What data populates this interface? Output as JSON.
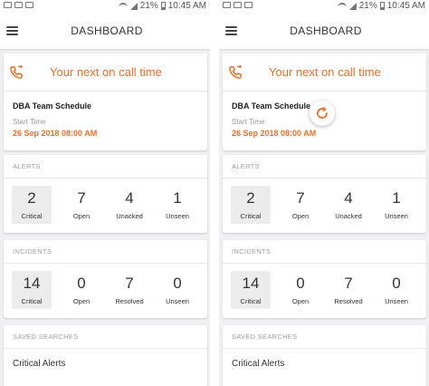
{
  "status_bar": {
    "battery": "21%",
    "time": "10:45 AM"
  },
  "app_bar": {
    "title": "DASHBOARD"
  },
  "on_call": {
    "title": "Your next on call time",
    "schedule_name": "DBA Team Schedule",
    "start_label": "Start Time",
    "start_value": "26 Sep 2018 08:00 AM"
  },
  "alerts": {
    "label": "ALERTS",
    "stats": [
      {
        "value": "2",
        "label": "Critical"
      },
      {
        "value": "7",
        "label": "Open"
      },
      {
        "value": "4",
        "label": "Unacked"
      },
      {
        "value": "1",
        "label": "Unseen"
      }
    ]
  },
  "incidents": {
    "label": "INCIDENTS",
    "stats": [
      {
        "value": "14",
        "label": "Critical"
      },
      {
        "value": "0",
        "label": "Open"
      },
      {
        "value": "7",
        "label": "Resolved"
      },
      {
        "value": "0",
        "label": "Unseen"
      }
    ]
  },
  "saved_searches": {
    "label": "SAVED SEARCHES",
    "items": [
      "Critical Alerts"
    ]
  },
  "colors": {
    "accent": "#e8702a"
  }
}
